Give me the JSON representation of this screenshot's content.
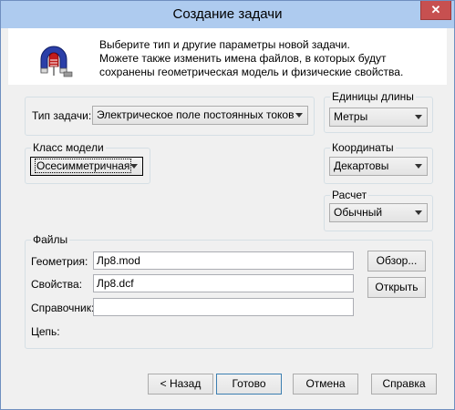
{
  "window": {
    "title": "Создание задачи",
    "close_glyph": "✕"
  },
  "intro_text": "Выберите тип и другие параметры новой задачи.\nМожете также изменить имена файлов, в которых будут\nсохранены геометрическая модель и физические свойства.",
  "intro_lines": [
    "Выберите тип и другие параметры новой задачи.",
    "Можете также изменить имена файлов, в которых будут",
    "сохранены геометрическая модель и физические свойства."
  ],
  "icon": "magnet-icon",
  "problem_type": {
    "label": "Тип задачи:",
    "value": "Электрическое поле постоянных токов"
  },
  "model_class": {
    "label": "Класс модели",
    "value": "Осесимметричная"
  },
  "length_units": {
    "label": "Единицы длины",
    "value": "Метры"
  },
  "coordinates": {
    "label": "Координаты",
    "value": "Декартовы"
  },
  "calculation": {
    "label": "Расчет",
    "value": "Обычный"
  },
  "files": {
    "label": "Файлы",
    "geometry": {
      "label": "Геометрия:",
      "value": "Лр8.mod"
    },
    "properties": {
      "label": "Свойства:",
      "value": "Лр8.dcf"
    },
    "reference": {
      "label": "Справочник:",
      "value": ""
    },
    "circuit": {
      "label": "Цепь:"
    },
    "browse_label": "Обзор...",
    "open_label": "Открыть"
  },
  "buttons": {
    "back": "< Назад",
    "done": "Готово",
    "cancel": "Отмена",
    "help": "Справка"
  },
  "colors": {
    "titlebar": "#aecbef",
    "close": "#c75050",
    "dialog_bg": "#f0f0f0"
  }
}
